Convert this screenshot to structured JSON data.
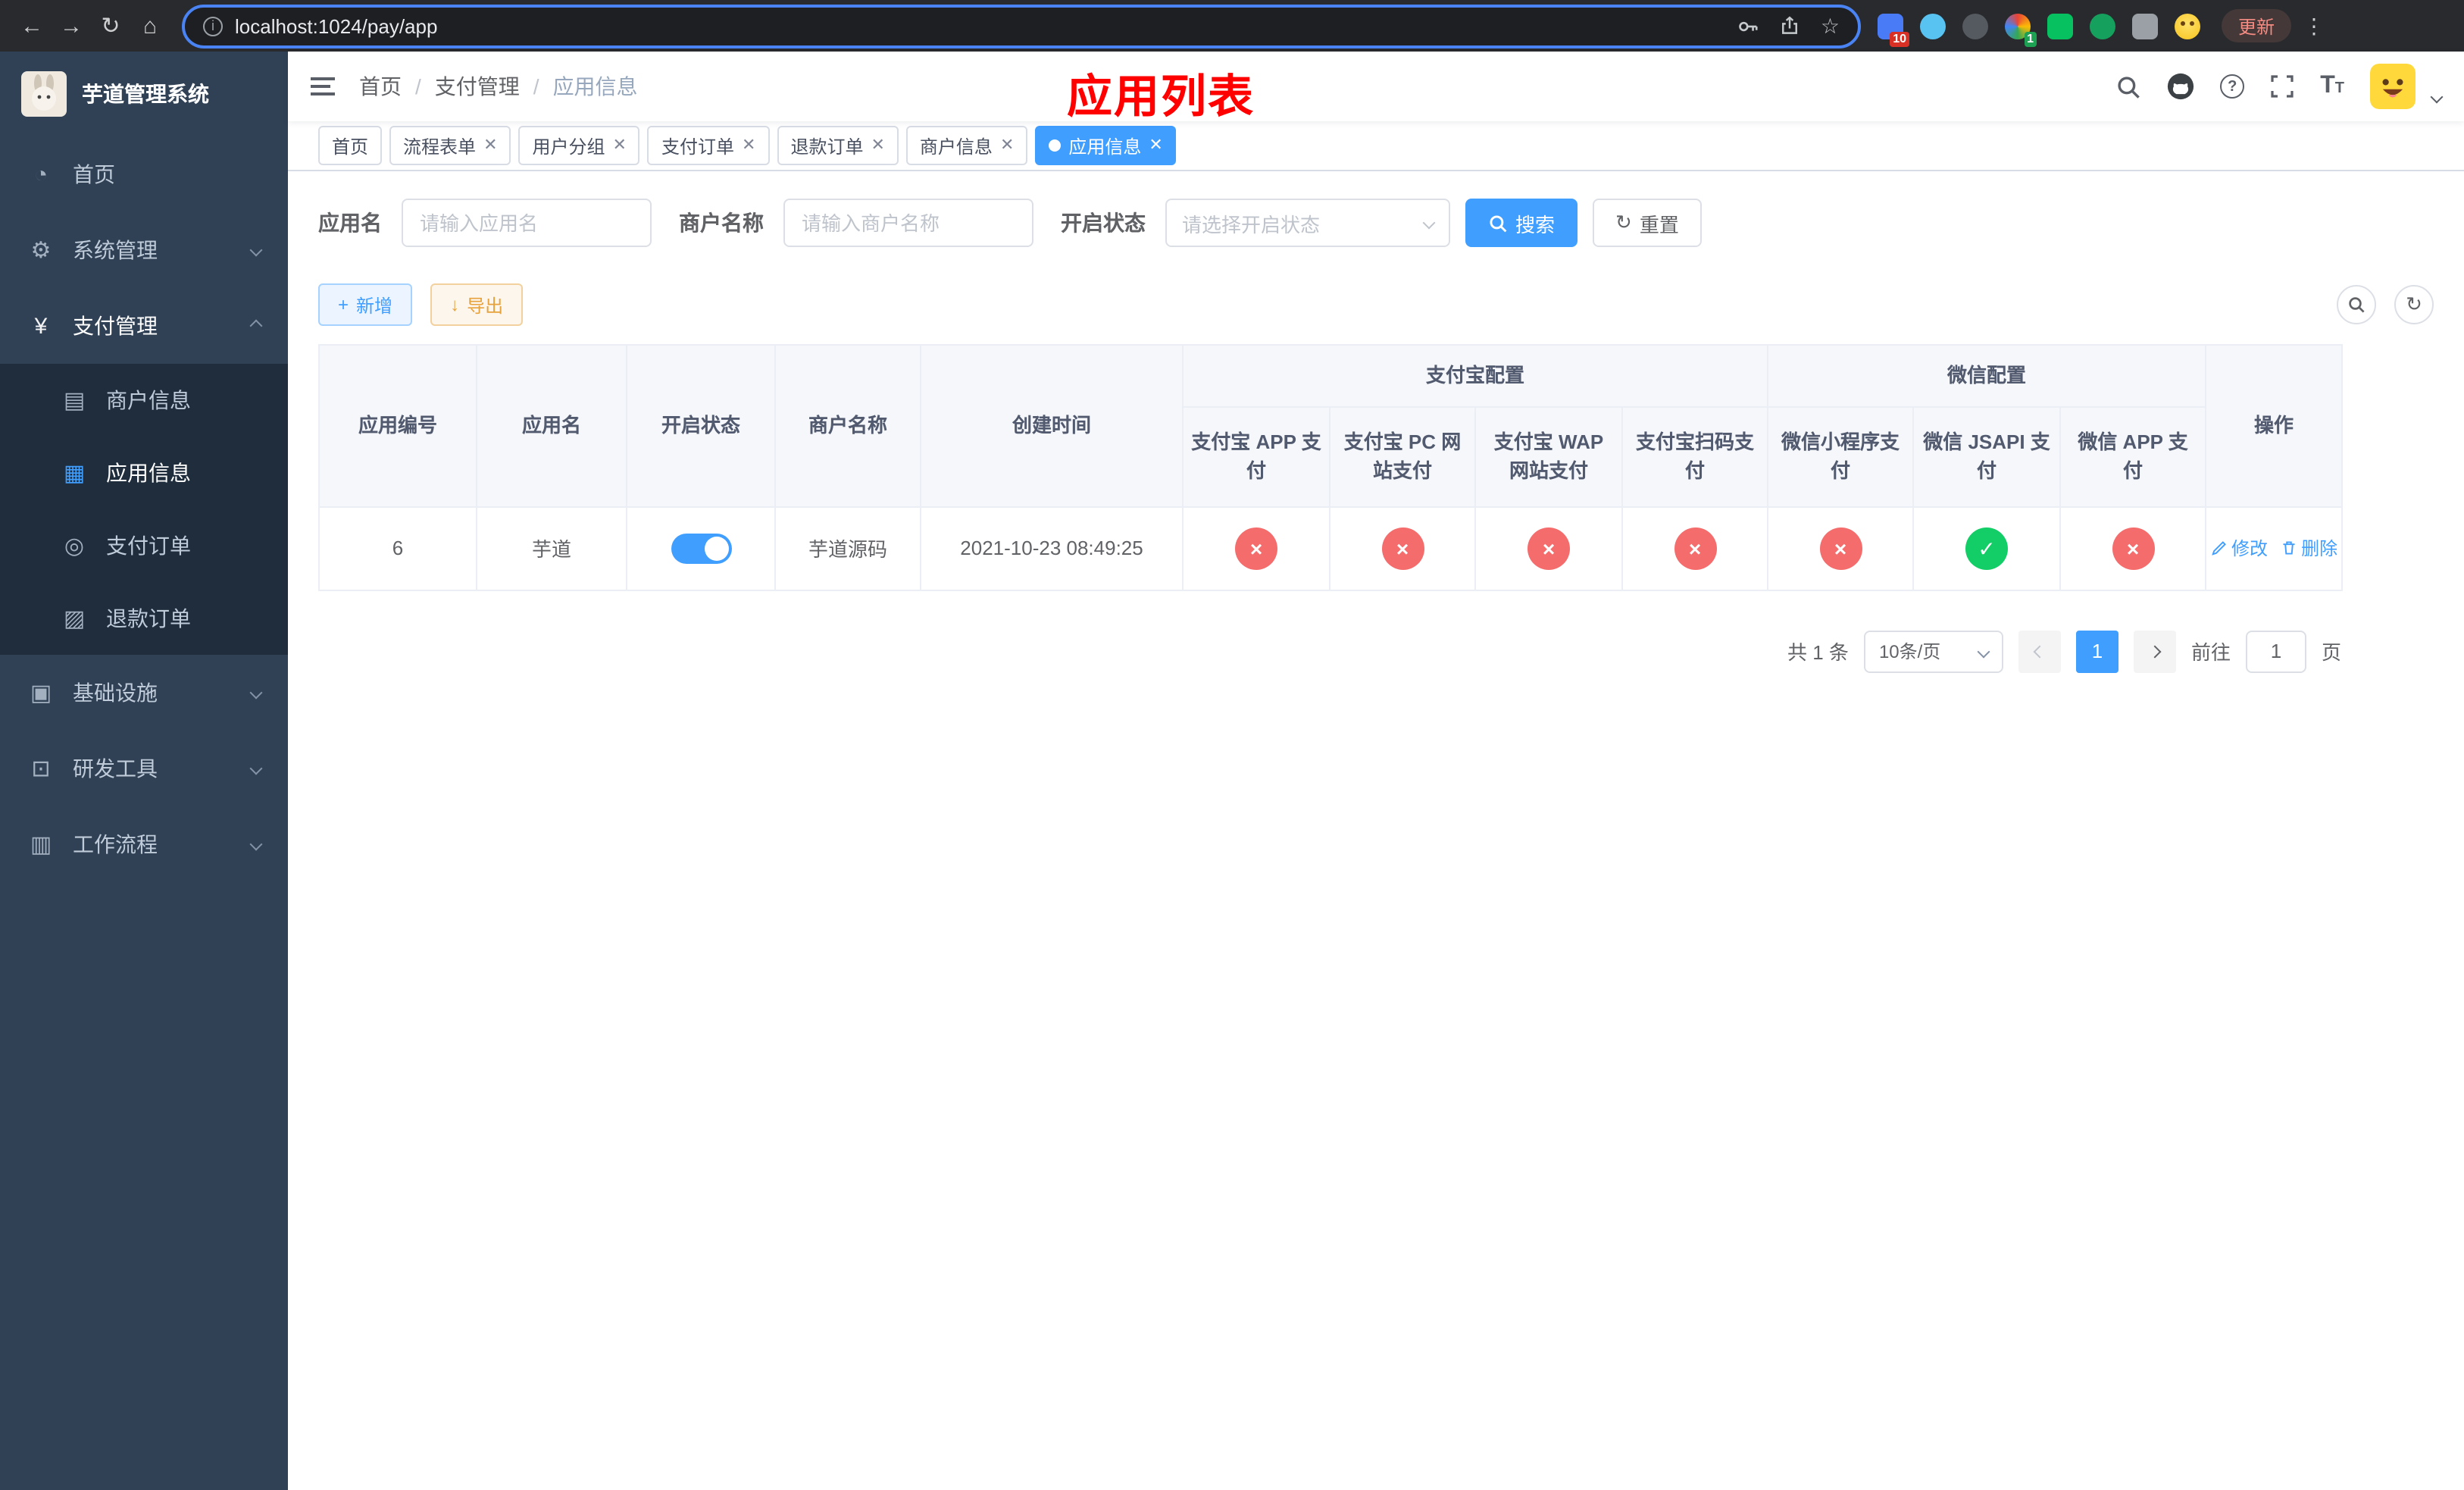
{
  "browser": {
    "url": "localhost:1024/pay/app",
    "update_button": "更新",
    "ext_badges": [
      "10",
      "1"
    ]
  },
  "colors": {
    "accent": "#409eff",
    "success": "#13ce66",
    "danger": "#f56c6c",
    "warning": "#e6a23c",
    "title_red": "#ff0000",
    "sidebar_bg": "#304156",
    "submenu_bg": "#1f2d3d"
  },
  "icons": {
    "cross": "×",
    "check": "✓",
    "plus": "+",
    "download": "↓",
    "refresh": "↻",
    "back": "←",
    "forward": "→",
    "home": "⌂",
    "star": "☆",
    "dots": "⋮",
    "info": "i",
    "question": "?"
  },
  "sidebar": {
    "title": "芋道管理系统",
    "items": [
      {
        "label": "首页"
      },
      {
        "label": "系统管理"
      },
      {
        "label": "支付管理"
      },
      {
        "label": "基础设施"
      },
      {
        "label": "研发工具"
      },
      {
        "label": "工作流程"
      }
    ],
    "payment_submenu": [
      {
        "label": "商户信息"
      },
      {
        "label": "应用信息"
      },
      {
        "label": "支付订单"
      },
      {
        "label": "退款订单"
      }
    ]
  },
  "header": {
    "breadcrumb": [
      "首页",
      "支付管理",
      "应用信息"
    ],
    "page_title": "应用列表",
    "text_size_big": "T",
    "text_size_small": "T"
  },
  "tabs": [
    {
      "label": "首页"
    },
    {
      "label": "流程表单"
    },
    {
      "label": "用户分组"
    },
    {
      "label": "支付订单"
    },
    {
      "label": "退款订单"
    },
    {
      "label": "商户信息"
    },
    {
      "label": "应用信息"
    }
  ],
  "filters": {
    "app_name_label": "应用名",
    "app_name_placeholder": "请输入应用名",
    "merchant_label": "商户名称",
    "merchant_placeholder": "请输入商户名称",
    "status_label": "开启状态",
    "status_placeholder": "请选择开启状态",
    "search_button": "搜索",
    "reset_button": "重置"
  },
  "toolbar": {
    "add_button": "新增",
    "export_button": "导出"
  },
  "table": {
    "group_headers": {
      "alipay": "支付宝配置",
      "wechat": "微信配置"
    },
    "columns": {
      "app_id": "应用编号",
      "app_name": "应用名",
      "status": "开启状态",
      "merchant": "商户名称",
      "created": "创建时间",
      "alipay_app": "支付宝 APP 支付",
      "alipay_pc": "支付宝 PC 网站支付",
      "alipay_wap": "支付宝 WAP 网站支付",
      "alipay_qr": "支付宝扫码支付",
      "wx_mini": "微信小程序支付",
      "wx_jsapi": "微信 JSAPI 支付",
      "wx_app": "微信 APP 支付",
      "actions": "操作"
    },
    "rows": [
      {
        "app_id": "6",
        "app_name": "芋道",
        "status_enabled": true,
        "merchant": "芋道源码",
        "created": "2021-10-23 08:49:25",
        "alipay_app": false,
        "alipay_pc": false,
        "alipay_wap": false,
        "alipay_qr": false,
        "wx_mini": false,
        "wx_jsapi": true,
        "wx_app": false,
        "edit_label": "修改",
        "delete_label": "删除"
      }
    ]
  },
  "pagination": {
    "total_text": "共 1 条",
    "page_size": "10条/页",
    "current_page": "1",
    "goto_prefix": "前往",
    "goto_value": "1",
    "goto_suffix": "页"
  }
}
